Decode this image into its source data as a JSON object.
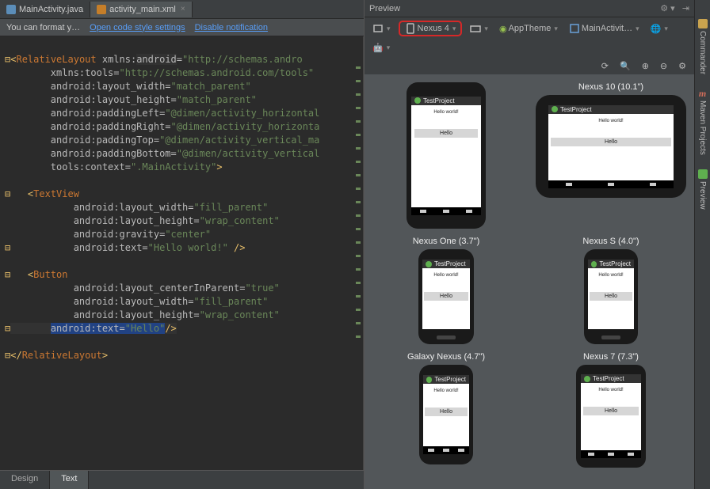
{
  "tabs": {
    "file1": "MainActivity.java",
    "file2": "activity_main.xml"
  },
  "banner": {
    "msg": "You can format y…",
    "link1": "Open code style settings",
    "link2": "Disable notification"
  },
  "bottom_tabs": {
    "design": "Design",
    "text": "Text"
  },
  "preview": {
    "title": "Preview",
    "device_selected": "Nexus 4",
    "apptheme": "AppTheme",
    "mainactivity": "MainActivit…"
  },
  "devices": {
    "n4": "",
    "n10": "Nexus 10 (10.1\")",
    "none": "Nexus One (3.7\")",
    "ns": "Nexus S (4.0\")",
    "gn": "Galaxy Nexus (4.7\")",
    "n7": "Nexus 7 (7.3\")"
  },
  "app": {
    "title": "TestProject",
    "text": "Hello world!",
    "button": "Hello"
  },
  "side": {
    "commander": "Commander",
    "maven": "Maven Projects",
    "preview": "Preview"
  },
  "code": {
    "l1a": "<",
    "l1b": "RelativeLayout",
    "l1c": " xmlns:",
    "l1d": "android",
    "l1e": "=\"http://schemas.andro",
    "l2": "        xmlns:tools=\"http://schemas.android.com/tools\"",
    "l3": "        android:layout_width=\"match_parent\"",
    "l4": "        android:layout_height=\"match_parent\"",
    "l5": "        android:paddingLeft=\"@dimen/activity_horizontal",
    "l6": "        android:paddingRight=\"@dimen/activity_horizonta",
    "l7": "        android:paddingTop=\"@dimen/activity_vertical_ma",
    "l8": "        android:paddingBottom=\"@dimen/activity_vertical",
    "l9": "        tools:context=\".MainActivity\">",
    "l11": "    <TextView",
    "l12": "            android:layout_width=\"fill_parent\"",
    "l13": "            android:layout_height=\"wrap_content\"",
    "l14": "            android:gravity=\"center\"",
    "l15": "            android:text=\"Hello world!\" />",
    "l17": "    <Button",
    "l18": "            android:layout_centerInParent=\"true\"",
    "l19": "            android:layout_width=\"fill_parent\"",
    "l20": "            android:layout_height=\"wrap_content\"",
    "l21a": "        ",
    "l21b": "android:text=",
    "l21c": "\"Hello\"",
    "l21d": "/>",
    "l23": "</RelativeLayout>"
  }
}
